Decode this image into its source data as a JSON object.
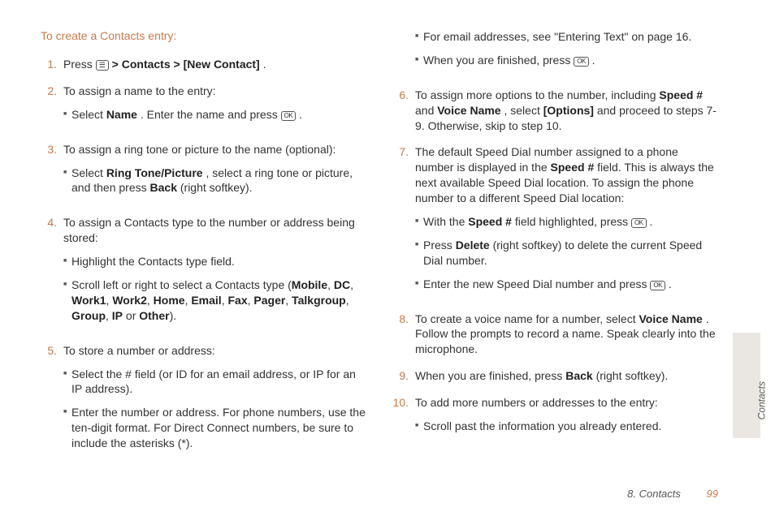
{
  "heading": "To create a Contacts entry:",
  "icons": {
    "menu": "☰",
    "ok": "OK"
  },
  "col1": {
    "s1": {
      "num": "1.",
      "a": "Press ",
      "b": " > ",
      "c": "Contacts",
      "d": " > ",
      "e": "[New Contact]",
      "f": "."
    },
    "s2": {
      "num": "2.",
      "text": "To assign a name to the entry:",
      "sub1a": "Select ",
      "sub1b": "Name",
      "sub1c": ". Enter the name and press ",
      "sub1d": "."
    },
    "s3": {
      "num": "3.",
      "text": "To assign a ring tone or picture to the name (optional):",
      "sub1a": "Select ",
      "sub1b": "Ring Tone/Picture",
      "sub1c": ", select a ring tone or picture, and then press ",
      "sub1d": "Back",
      "sub1e": " (right softkey)."
    },
    "s4": {
      "num": "4.",
      "text": "To assign a Contacts type to the number or address being stored:",
      "sub1": "Highlight the Contacts type field.",
      "sub2a": "Scroll left or right to select a Contacts type (",
      "m1": "Mobile",
      "c": ", ",
      "m2": "DC",
      "m3": "Work1",
      "m4": "Work2",
      "m5": "Home",
      "m6": "Email",
      "m7": "Fax",
      "m8": "Pager",
      "m9": "Talkgroup",
      "m10": "Group",
      "m11": "IP",
      "or": " or ",
      "m12": "Other",
      "end": ")."
    },
    "s5": {
      "num": "5.",
      "text": "To store a number or address:",
      "sub1": "Select the # field (or ID for an email address, or IP for an IP address).",
      "sub2": "Enter the number or address. For phone numbers, use the ten-digit format. For Direct Connect numbers, be sure to include the asterisks (*)."
    }
  },
  "col2": {
    "s5c": {
      "sub3a": "For email addresses, see \"Entering Text\" on page 16.",
      "sub4a": "When you are finished, press ",
      "sub4b": "."
    },
    "s6": {
      "num": "6.",
      "a": "To assign more options to the number, including ",
      "b": "Speed #",
      "c": " and ",
      "d": "Voice Name",
      "e": ", select ",
      "f": "[Options]",
      "g": " and proceed to steps 7-9. Otherwise, skip to step 10."
    },
    "s7": {
      "num": "7.",
      "a": "The default Speed Dial number assigned to a phone number is displayed in the ",
      "b": "Speed #",
      "c": " field. This is always the next available Speed Dial location. To assign the phone number to a different Speed Dial location:",
      "sub1a": "With the ",
      "sub1b": "Speed #",
      "sub1c": " field highlighted, press ",
      "sub1d": ".",
      "sub2a": "Press ",
      "sub2b": "Delete",
      "sub2c": " (right softkey) to delete the current Speed Dial number.",
      "sub3a": "Enter the new Speed Dial number and press ",
      "sub3b": "."
    },
    "s8": {
      "num": "8.",
      "a": "To create a voice name for a number, select ",
      "b": "Voice Name",
      "c": ". Follow the prompts to record a name. Speak clearly into the microphone."
    },
    "s9": {
      "num": "9.",
      "a": "When you are finished, press ",
      "b": "Back",
      "c": " (right softkey)."
    },
    "s10": {
      "num": "10.",
      "text": "To add more numbers or addresses to the entry:",
      "sub1": "Scroll past the information you already entered."
    }
  },
  "footer": {
    "chapter": "8. Contacts",
    "page": "99"
  },
  "side": "Contacts"
}
